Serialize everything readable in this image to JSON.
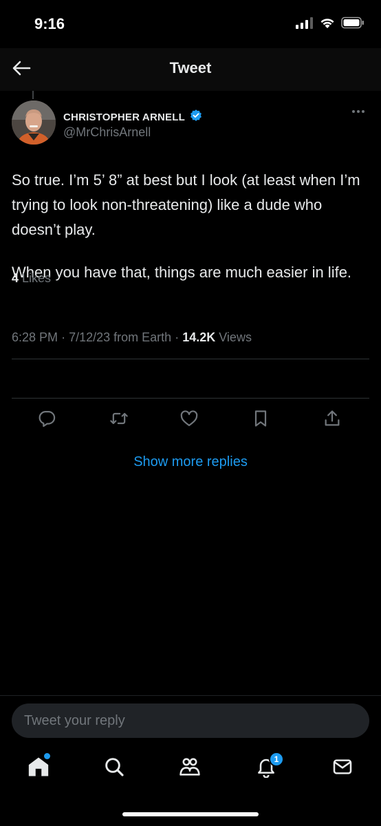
{
  "status_bar": {
    "time": "9:16",
    "icons": [
      "signal-icon",
      "wifi-icon",
      "battery-icon"
    ]
  },
  "header": {
    "title": "Tweet",
    "back_icon": "arrow-left-icon"
  },
  "tweet": {
    "author_name": "CHRISTOPHER ARNELL",
    "verified_icon": "verified-badge-icon",
    "handle": "@MrChrisArnell",
    "paragraphs": [
      "So true. I’m 5’ 8” at best but I look (at least when I’m trying to look non-threatening) like a dude who doesn’t play.",
      "When you have that, things are much easier in life."
    ],
    "time": "6:28 PM",
    "date": "7/12/23",
    "source": "from Earth",
    "views_count": "14.2K",
    "views_label": "Views",
    "likes_count": "4",
    "likes_label": "Likes"
  },
  "actions": [
    {
      "name": "reply",
      "icon": "reply-icon"
    },
    {
      "name": "retweet",
      "icon": "retweet-icon"
    },
    {
      "name": "like",
      "icon": "heart-icon"
    },
    {
      "name": "bookmark",
      "icon": "bookmark-icon"
    },
    {
      "name": "share",
      "icon": "share-icon"
    }
  ],
  "show_more_replies": "Show more replies",
  "reply": {
    "placeholder": "Tweet your reply"
  },
  "tab_bar": {
    "items": [
      "home-icon",
      "search-icon",
      "communities-icon",
      "notifications-icon",
      "messages-icon"
    ],
    "notifications_badge": "1"
  },
  "colors": {
    "background": "#000000",
    "accent": "#1d9bf0",
    "text_primary": "#e7e9ea",
    "text_secondary": "#71767b",
    "divider": "#2f3336"
  }
}
